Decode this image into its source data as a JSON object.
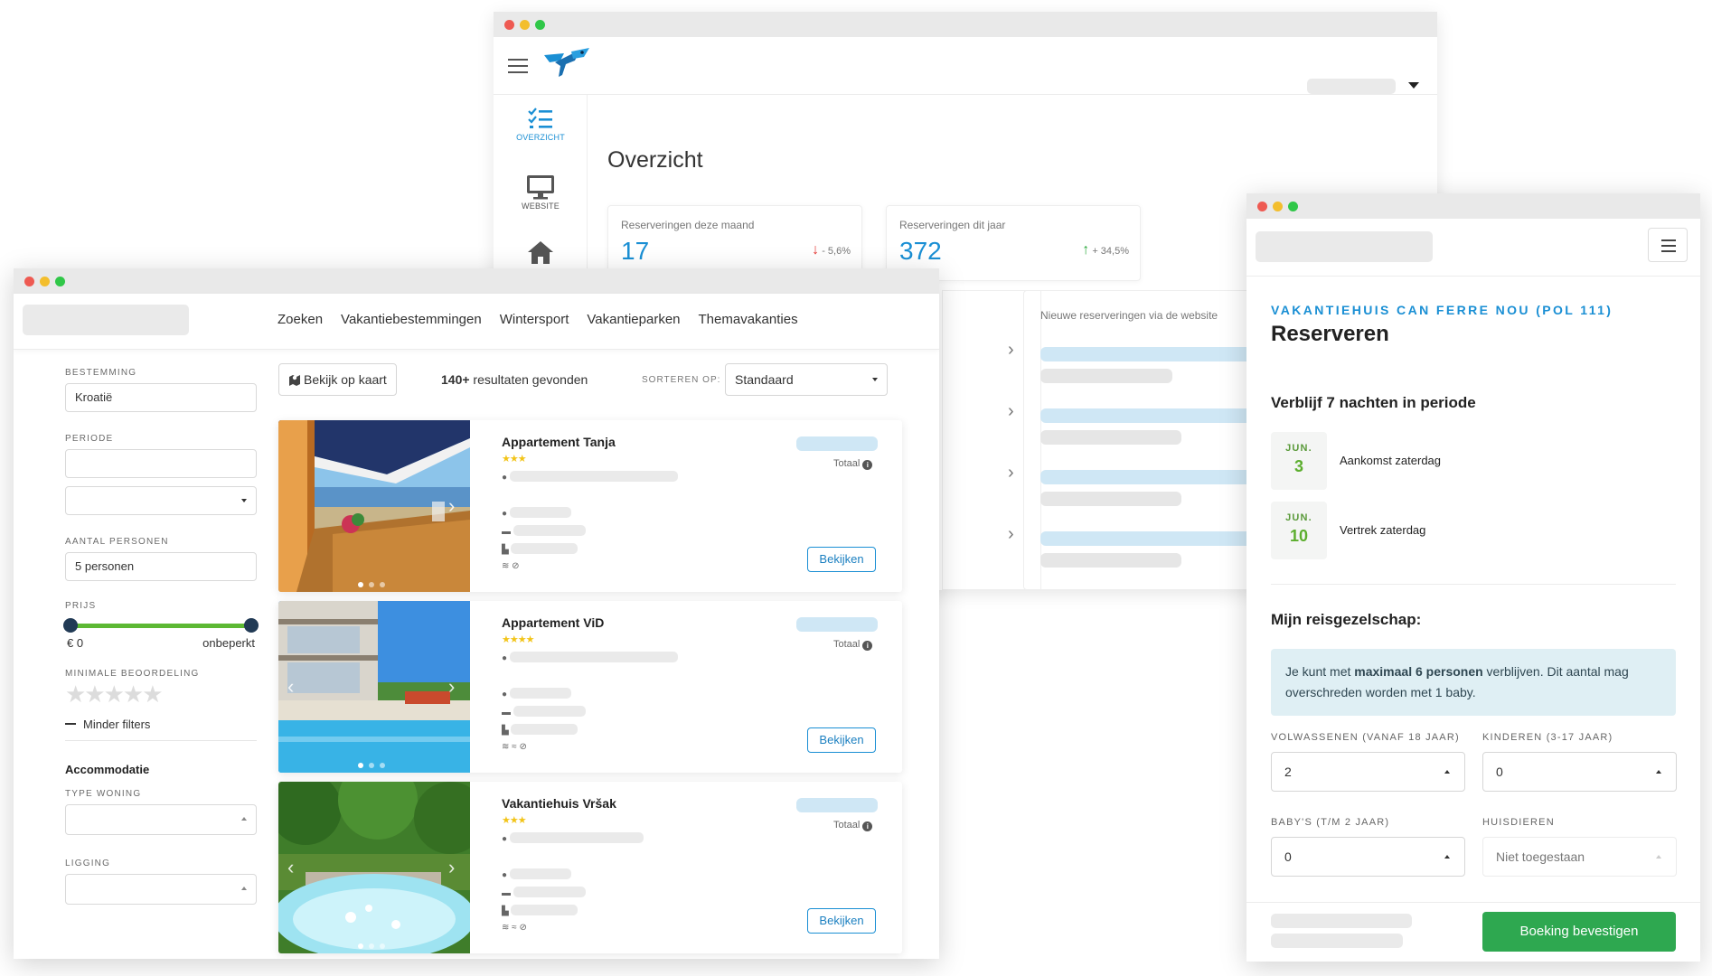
{
  "dashboard": {
    "sidebar": [
      {
        "label": "OVERZICHT",
        "icon": "list-check-icon"
      },
      {
        "label": "WEBSITE",
        "icon": "monitor-icon"
      },
      {
        "label": "",
        "icon": "home-icon"
      }
    ],
    "title": "Overzicht",
    "stats": [
      {
        "label": "Reserveringen deze maand",
        "value": "17",
        "change": "- 5,6%",
        "trend": "down"
      },
      {
        "label": "Reserveringen dit jaar",
        "value": "372",
        "change": "+ 34,5%",
        "trend": "up"
      }
    ],
    "new_reservations_label": "Nieuwe reserveringen via de website"
  },
  "search": {
    "nav": [
      "Zoeken",
      "Vakantiebestemmingen",
      "Wintersport",
      "Vakantieparken",
      "Themavakanties"
    ],
    "filters": {
      "destination_label": "BESTEMMING",
      "destination_value": "Kroatië",
      "period_label": "PERIODE",
      "persons_label": "AANTAL PERSONEN",
      "persons_value": "5 personen",
      "price_label": "PRIJS",
      "price_min": "€ 0",
      "price_max": "onbeperkt",
      "rating_label": "MINIMALE BEOORDELING",
      "less_filters": "Minder filters",
      "accommodation_heading": "Accommodatie",
      "type_label": "TYPE WONING",
      "location_label": "LIGGING"
    },
    "map_button": "Bekijk op kaart",
    "results_count": "140+",
    "results_suffix": " resultaten gevonden",
    "sort_label": "SORTEREN OP:",
    "sort_value": "Standaard",
    "listings": [
      {
        "title": "Appartement Tanja",
        "stars": "★★★",
        "total": "Totaal",
        "button": "Bekijken"
      },
      {
        "title": "Appartement ViD",
        "stars": "★★★★",
        "total": "Totaal",
        "button": "Bekijken"
      },
      {
        "title": "Vakantiehuis Vršak",
        "stars": "★★★",
        "total": "Totaal",
        "button": "Bekijken"
      }
    ]
  },
  "booking": {
    "eyebrow": "VAKANTIEHUIS CAN FERRE NOU (POL 111)",
    "title": "Reserveren",
    "stay_heading": "Verblijf 7 nachten in periode",
    "arrival": {
      "month": "JUN.",
      "day": "3",
      "label": "Aankomst zaterdag"
    },
    "departure": {
      "month": "JUN.",
      "day": "10",
      "label": "Vertrek zaterdag"
    },
    "party_heading": "Mijn reisgezelschap:",
    "alert_pre": "Je kunt met ",
    "alert_bold": "maximaal 6 personen",
    "alert_post": " verblijven. Dit aantal mag overschreden worden met 1 baby.",
    "adults_label": "VOLWASSENEN (VANAF 18 JAAR)",
    "adults_value": "2",
    "children_label": "KINDEREN (3-17 JAAR)",
    "children_value": "0",
    "babies_label": "BABY'S (T/M 2 JAAR)",
    "babies_value": "0",
    "pets_label": "HUISDIEREN",
    "pets_value": "Niet toegestaan",
    "confirm_button": "Boeking bevestigen"
  }
}
